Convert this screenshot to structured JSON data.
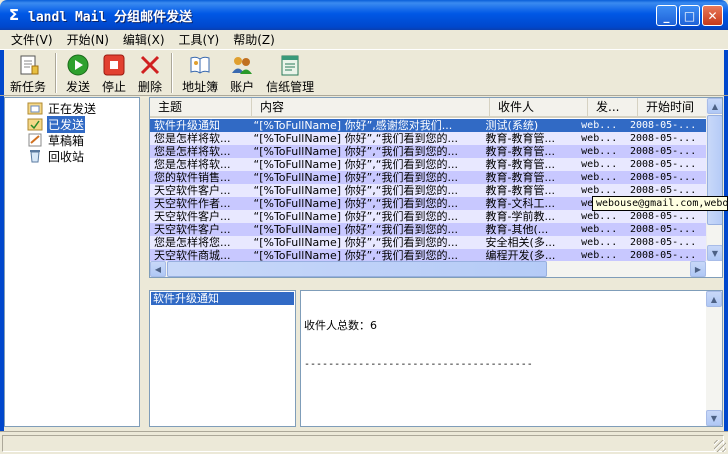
{
  "window": {
    "title": "landl Mail 分组邮件发送"
  },
  "menu": [
    "文件(V)",
    "开始(N)",
    "编辑(X)",
    "工具(Y)",
    "帮助(Z)"
  ],
  "toolbar": {
    "new_task": "新任务",
    "send": "发送",
    "stop": "停止",
    "delete": "删除",
    "address_book": "地址簿",
    "account": "账户",
    "stationery": "信纸管理"
  },
  "tree": [
    {
      "label": "正在发送",
      "icon": "folder-sending-icon"
    },
    {
      "label": "已发送",
      "icon": "folder-sent-icon",
      "selected": true
    },
    {
      "label": "草稿箱",
      "icon": "drafts-icon"
    },
    {
      "label": "回收站",
      "icon": "recycle-bin-icon"
    }
  ],
  "list": {
    "headers": [
      "主题",
      "内容",
      "收件人",
      "发...",
      "开始时间"
    ],
    "rows": [
      [
        "软件升级通知",
        "“[%ToFullName] 你好”,感谢您对我们...",
        "测试(系统)",
        "web...",
        "2008-05-..."
      ],
      [
        "您是怎样将软...",
        "“[%ToFullName] 你好”,“我们看到您的...",
        "教育-教育管...",
        "web...",
        "2008-05-..."
      ],
      [
        "您是怎样将软...",
        "“[%ToFullName] 你好”,“我们看到您的...",
        "教育-教育管...",
        "web...",
        "2008-05-..."
      ],
      [
        "您是怎样将软...",
        "“[%ToFullName] 你好”,“我们看到您的...",
        "教育-教育管...",
        "web...",
        "2008-05-..."
      ],
      [
        "您的软件销售...",
        "“[%ToFullName] 你好”,“我们看到您的...",
        "教育-教育管...",
        "web...",
        "2008-05-..."
      ],
      [
        "天空软件客户...",
        "“[%ToFullName] 你好”,“我们看到您的...",
        "教育-教育管...",
        "web...",
        "2008-05-..."
      ],
      [
        "天空软件作者...",
        "“[%ToFullName] 你好”,“我们看到您的...",
        "教育-文科工...",
        "web...",
        "2008-05-..."
      ],
      [
        "天空软件客户...",
        "“[%ToFullName] 你好”,“我们看到您的...",
        "教育-学前教...",
        "web...",
        "2008-05-..."
      ],
      [
        "天空软件客户...",
        "“[%ToFullName] 你好”,“我们看到您的...",
        "教育-其他(...",
        "web...",
        "2008-05-..."
      ],
      [
        "您是怎样将您...",
        "“[%ToFullName] 你好”,“我们看到您的...",
        "安全相关(多...",
        "web...",
        "2008-05-..."
      ],
      [
        "天空软件商城...",
        "“[%ToFullName] 你好”,“我们看到您的...",
        "编程开发(多...",
        "web...",
        "2008-05-..."
      ]
    ],
    "tooltip": "webouse@gmail.com,webo"
  },
  "subjects": [
    "软件升级通知"
  ],
  "detail": {
    "recipients_line": "收件人总数：6",
    "divider": "--------------------------------------"
  },
  "colors": {
    "titlebar": "#0058e6",
    "selection": "#316ac5",
    "row_odd": "#c8c8ff",
    "row_even": "#e8e8ff"
  }
}
